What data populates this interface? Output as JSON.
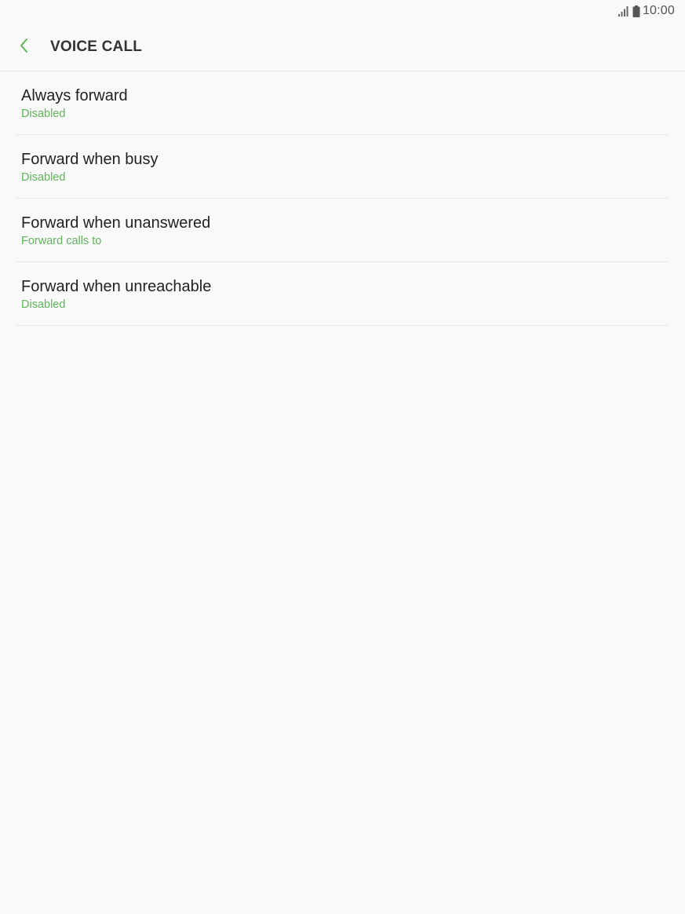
{
  "status_bar": {
    "time": "10:00",
    "icons": [
      "signal-icon",
      "battery-icon"
    ]
  },
  "header": {
    "back_icon": "chevron-left-icon",
    "title": "VOICE CALL"
  },
  "colors": {
    "accent": "#5fb55a",
    "background": "#f9f9f9",
    "title_text": "#222222",
    "divider": "#e8e8e8"
  },
  "list": {
    "items": [
      {
        "title": "Always forward",
        "subtitle": "Disabled"
      },
      {
        "title": "Forward when busy",
        "subtitle": "Disabled"
      },
      {
        "title": "Forward when unanswered",
        "subtitle": "Forward calls to"
      },
      {
        "title": "Forward when unreachable",
        "subtitle": "Disabled"
      }
    ]
  }
}
